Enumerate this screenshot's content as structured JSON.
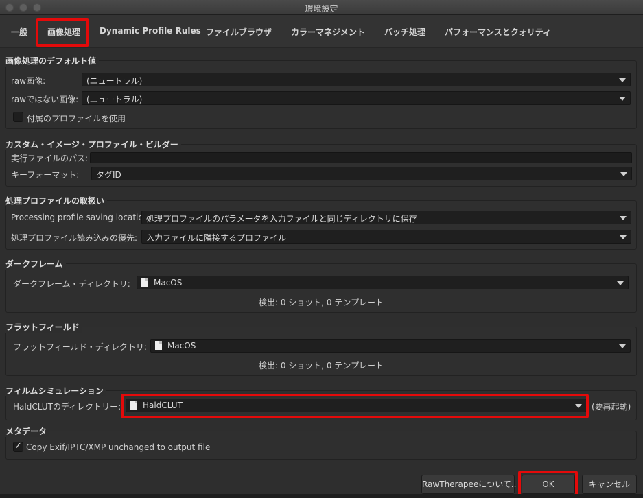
{
  "window": {
    "title": "環境設定"
  },
  "tabs": [
    "一般",
    "画像処理",
    "Dynamic Profile Rules",
    "ファイルブラウザ",
    "カラーマネジメント",
    "バッチ処理",
    "パフォーマンスとクォリティ"
  ],
  "defaults": {
    "title": "画像処理のデフォルト値",
    "raw_label": "raw画像:",
    "raw_value": "(ニュートラル)",
    "nonraw_label": "rawではない画像:",
    "nonraw_value": "(ニュートラル)",
    "sidecar_label": "付属のプロファイルを使用",
    "sidecar_checked": false
  },
  "custom_builder": {
    "title": "カスタム・イメージ・プロファイル・ビルダー",
    "path_label": "実行ファイルのパス:",
    "path_value": "",
    "keyformat_label": "キーフォーマット:",
    "keyformat_value": "タグID"
  },
  "profile_handling": {
    "title": "処理プロファイルの取扱い",
    "saving_label": "Processing profile saving location:",
    "saving_value": "処理プロファイルのパラメータを入力ファイルと同じディレクトリに保存",
    "priority_label": "処理プロファイル読み込みの優先:",
    "priority_value": "入力ファイルに隣接するプロファイル"
  },
  "dark_frame": {
    "title": "ダークフレーム",
    "dir_label": "ダークフレーム・ディレクトリ:",
    "dir_value": "MacOS",
    "found": "検出: 0 ショット, 0 テンプレート"
  },
  "flat_field": {
    "title": "フラットフィールド",
    "dir_label": "フラットフィールド・ディレクトリ:",
    "dir_value": "MacOS",
    "found": "検出: 0 ショット, 0 テンプレート"
  },
  "film_sim": {
    "title": "フィルムシミュレーション",
    "dir_label": "HaldCLUTのディレクトリー:",
    "dir_value": "HaldCLUT",
    "restart_note": "(要再起動)"
  },
  "metadata": {
    "title": "メタデータ",
    "copy_label": "Copy Exif/IPTC/XMP unchanged to output file",
    "copy_checked": true
  },
  "buttons": {
    "about": "RawTherapeeについて..",
    "ok": "OK",
    "cancel": "キャンセル"
  },
  "colors": {
    "highlight": "#e40a0a"
  }
}
